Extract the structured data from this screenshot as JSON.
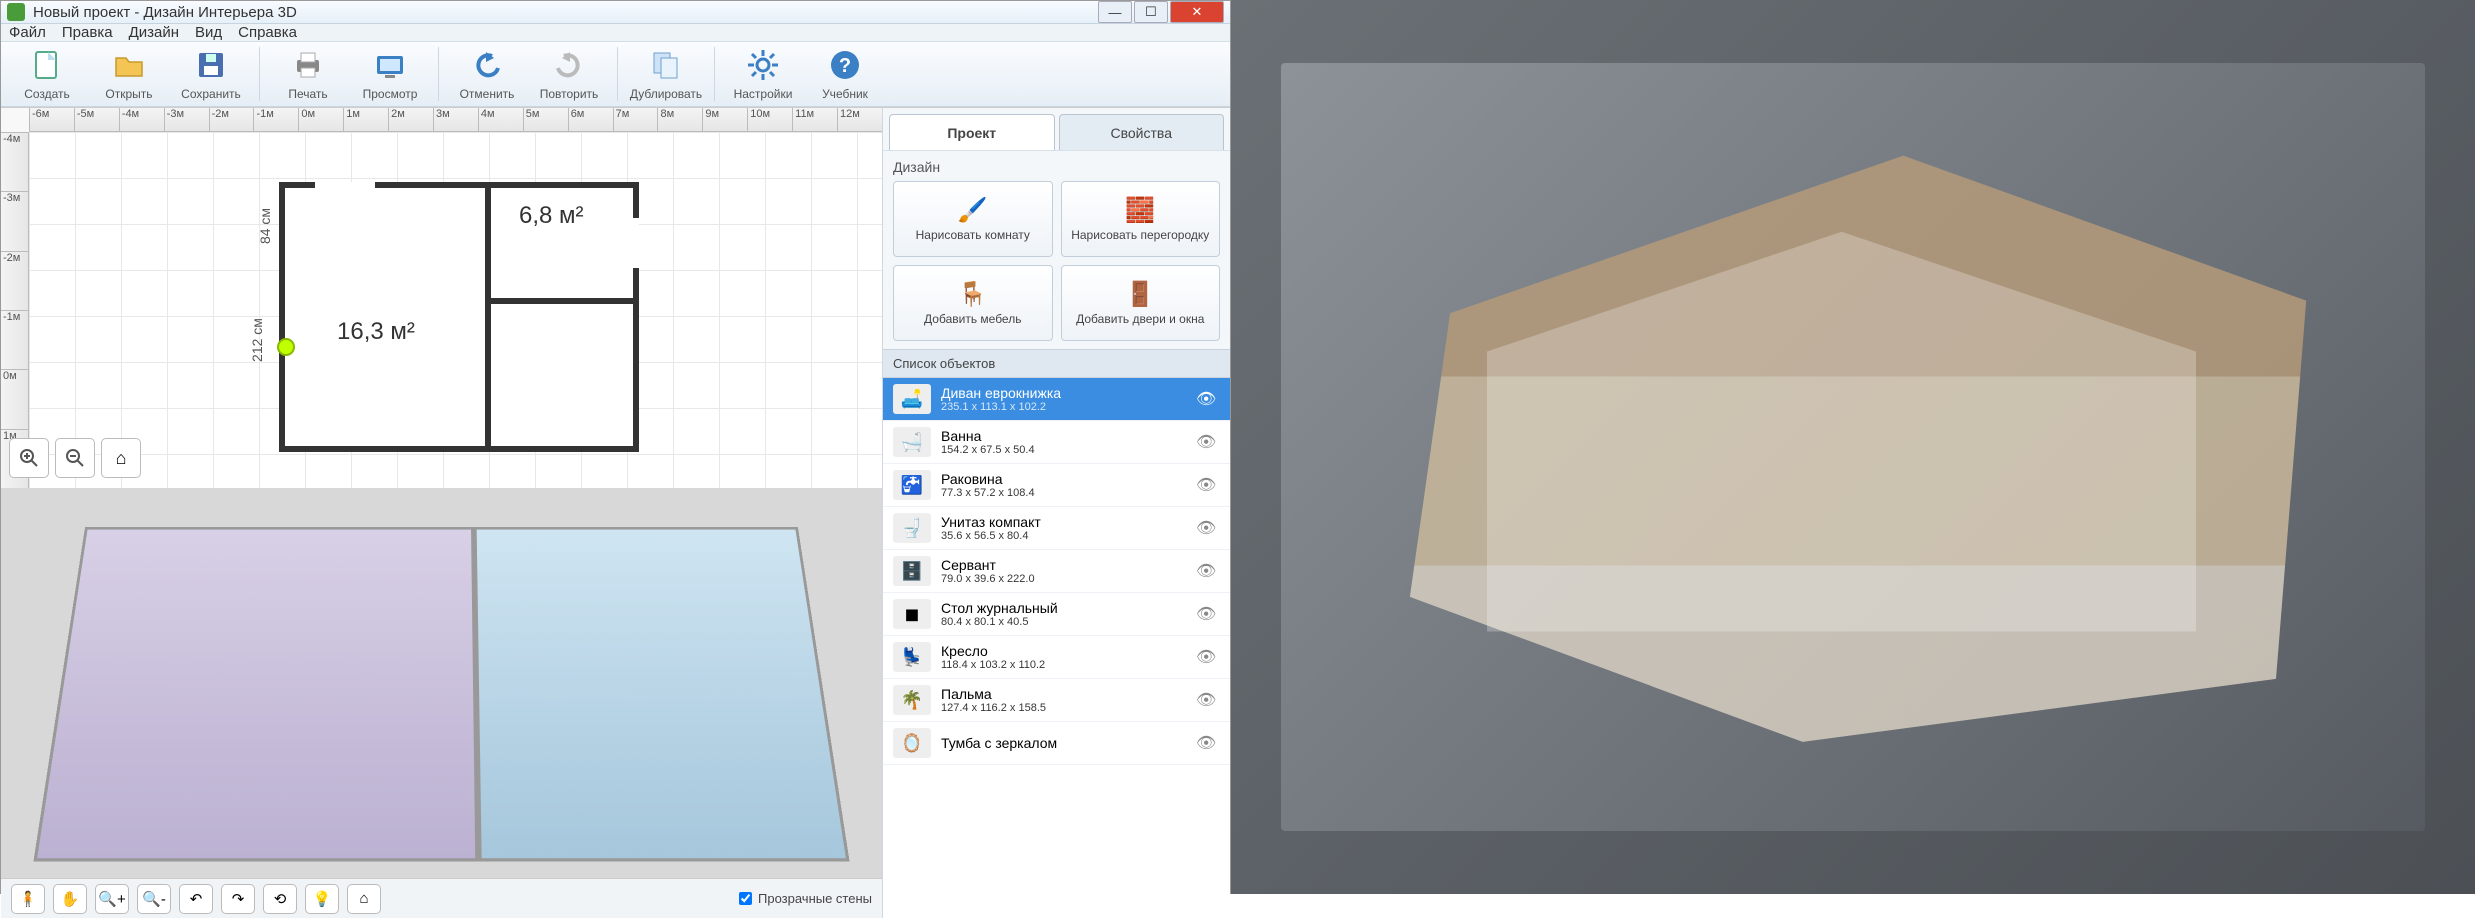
{
  "titlebar": {
    "title": "Новый проект - Дизайн Интерьера 3D"
  },
  "menu": [
    "Файл",
    "Правка",
    "Дизайн",
    "Вид",
    "Справка"
  ],
  "toolbar": [
    {
      "icon": "new",
      "label": "Создать"
    },
    {
      "icon": "open",
      "label": "Открыть"
    },
    {
      "icon": "save",
      "label": "Сохранить"
    },
    {
      "sep": true
    },
    {
      "icon": "print",
      "label": "Печать"
    },
    {
      "icon": "preview",
      "label": "Просмотр"
    },
    {
      "sep": true
    },
    {
      "icon": "undo",
      "label": "Отменить"
    },
    {
      "icon": "redo",
      "label": "Повторить"
    },
    {
      "sep": true
    },
    {
      "icon": "dup",
      "label": "Дублировать"
    },
    {
      "sep": true
    },
    {
      "icon": "settings",
      "label": "Настройки"
    },
    {
      "icon": "help",
      "label": "Учебник"
    }
  ],
  "ruler_h": [
    "-6м",
    "-5м",
    "-4м",
    "-3м",
    "-2м",
    "-1м",
    "0м",
    "1м",
    "2м",
    "3м",
    "4м",
    "5м",
    "6м",
    "7м",
    "8м",
    "9м",
    "10м",
    "11м",
    "12м"
  ],
  "ruler_v": [
    "-4м",
    "-3м",
    "-2м",
    "-1м",
    "0м",
    "1м"
  ],
  "rooms": {
    "room1_label": "16,3 м²",
    "room2_label": "6,8 м²",
    "dim_h": "84 см",
    "dim_v": "212 см"
  },
  "transparent_walls": "Прозрачные стены",
  "tabs": {
    "project": "Проект",
    "properties": "Свойства"
  },
  "design_section": "Дизайн",
  "design_buttons": [
    {
      "label": "Нарисовать комнату",
      "icon": "room"
    },
    {
      "label": "Нарисовать перегородку",
      "icon": "wall"
    },
    {
      "label": "Добавить мебель",
      "icon": "chair"
    },
    {
      "label": "Добавить двери и окна",
      "icon": "door"
    }
  ],
  "objects_header": "Список объектов",
  "objects": [
    {
      "name": "Диван еврокнижка",
      "dim": "235.1 x 113.1 x 102.2",
      "selected": true,
      "icon": "sofa"
    },
    {
      "name": "Ванна",
      "dim": "154.2 x 67.5 x 50.4",
      "icon": "bath"
    },
    {
      "name": "Раковина",
      "dim": "77.3 x 57.2 x 108.4",
      "icon": "sink"
    },
    {
      "name": "Унитаз компакт",
      "dim": "35.6 x 56.5 x 80.4",
      "icon": "toilet"
    },
    {
      "name": "Сервант",
      "dim": "79.0 x 39.6 x 222.0",
      "icon": "cabinet"
    },
    {
      "name": "Стол журнальный",
      "dim": "80.4 x 80.1 x 40.5",
      "icon": "table"
    },
    {
      "name": "Кресло",
      "dim": "118.4 x 103.2 x 110.2",
      "icon": "armchair"
    },
    {
      "name": "Пальма",
      "dim": "127.4 x 116.2 x 158.5",
      "icon": "plant"
    },
    {
      "name": "Тумба с зеркалом",
      "dim": "",
      "icon": "mirror"
    }
  ]
}
